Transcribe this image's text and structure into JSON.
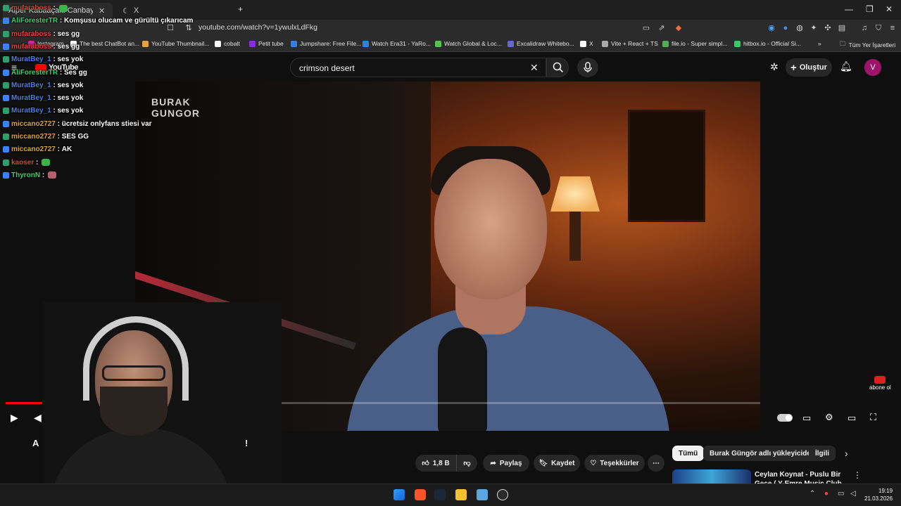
{
  "browser": {
    "tabs": [
      {
        "label": "Alper Kabaaçalu Canbay Olay"
      },
      {
        "label": "X"
      }
    ],
    "url": "youtube.com/watch?v=1ywulxLdFkg",
    "bookmarks": [
      {
        "label": "Instagram",
        "color": "#d6249f"
      },
      {
        "label": "The best ChatBot an...",
        "color": "#ffffff"
      },
      {
        "label": "YouTube Thumbnail...",
        "color": "#e8a33d"
      },
      {
        "label": "cobalt",
        "color": "#ffffff"
      },
      {
        "label": "Petit tube",
        "color": "#8a2be2"
      },
      {
        "label": "Jumpshare: Free File...",
        "color": "#2f80ed"
      },
      {
        "label": "Watch Era31 - YaRo...",
        "color": "#1e88e5"
      },
      {
        "label": "Watch Global & Loc...",
        "color": "#53c34b"
      },
      {
        "label": "Excalidraw Whitebo...",
        "color": "#6965db"
      },
      {
        "label": "X",
        "color": "#ffffff"
      },
      {
        "label": "Vite + React + TS",
        "color": "#aaaaaa"
      },
      {
        "label": "file.io - Super simpl...",
        "color": "#4caf50"
      },
      {
        "label": "hitbox.io - Official Si...",
        "color": "#33cc66"
      },
      {
        "label": "Tüm Yer İşaretleri",
        "color": "#cccccc"
      }
    ]
  },
  "youtube": {
    "logo": "YouTube",
    "search_value": "crimson desert",
    "create_label": "Oluştur",
    "avatar_letter": "V",
    "channel_logo_line1": "BURAK",
    "channel_logo_line2": "GUNGOR",
    "subscribe_watermark": "abone ol",
    "progress": 0.055,
    "title_start": "A",
    "title_end": "!",
    "actions": {
      "likes": "1,8 B",
      "share": "Paylaş",
      "save": "Kaydet",
      "thanks": "Teşekkürler"
    },
    "chips": [
      "Tümü",
      "Burak Güngör adlı yükleyiciden",
      "İlgili"
    ],
    "recommendation_title": "Ceylan Koynat - Puslu Bir Gece ( Y-Emre Music Club Remix )"
  },
  "chat": [
    {
      "user": "mufaraboss",
      "text": "",
      "color": "#e0443a",
      "emote": "#3bb54a"
    },
    {
      "user": "AliForesterTR",
      "text": "Komşusu olucam ve gürültü çıkarıcam",
      "color": "#3ecf6e"
    },
    {
      "user": "mufaraboss",
      "text": "ses gg",
      "color": "#e0443a"
    },
    {
      "user": "mufaraboss",
      "text": "ses gg",
      "color": "#e0443a"
    },
    {
      "user": "MuratBey_1",
      "text": "ses yok",
      "color": "#4a7dde"
    },
    {
      "user": "AliForesterTR",
      "text": "Ses gg",
      "color": "#3ecf6e"
    },
    {
      "user": "MuratBey_1",
      "text": "ses yok",
      "color": "#4a7dde"
    },
    {
      "user": "MuratBey_1",
      "text": "ses yok",
      "color": "#4a7dde"
    },
    {
      "user": "MuratBey_1",
      "text": "ses yok",
      "color": "#4a7dde"
    },
    {
      "user": "miccano2727",
      "text": "ücretsiz onlyfans stiesi var",
      "color": "#d9a441"
    },
    {
      "user": "miccano2727",
      "text": "SES GG",
      "color": "#d9a441"
    },
    {
      "user": "miccano2727",
      "text": "AK",
      "color": "#d9a441"
    },
    {
      "user": "kaoser",
      "text": "",
      "color": "#e0443a",
      "emote": "#3bb54a"
    },
    {
      "user": "ThyronN",
      "text": "",
      "color": "#3ecf6e",
      "emote": "#b5606a"
    }
  ],
  "taskbar": {
    "time": "19:19",
    "date": "21.03.2026"
  }
}
